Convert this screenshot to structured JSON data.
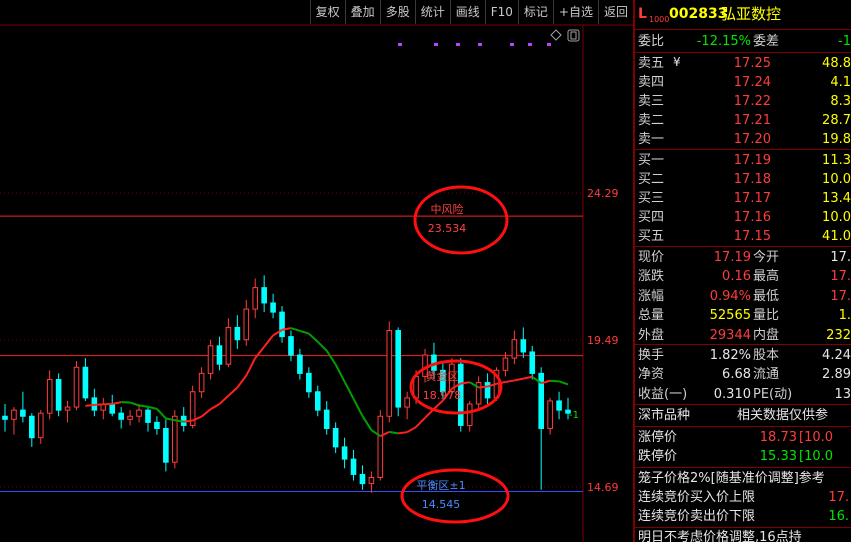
{
  "toolbar": {
    "buttons": [
      "复权",
      "叠加",
      "多股",
      "统计",
      "画线",
      "F10",
      "标记",
      "+自选",
      "返回"
    ]
  },
  "axis": {
    "price_labels": [
      "24.29",
      "19.49",
      "14.69"
    ]
  },
  "annotations": {
    "risk": {
      "title": "中风险",
      "value": "23.534"
    },
    "gold": {
      "title": "黄金区",
      "value": "18.978"
    },
    "balance": {
      "title": "平衡区±1",
      "value": "14.545"
    },
    "right_mark": "-1"
  },
  "stock": {
    "code": "002833",
    "name": "弘亚数控",
    "badge_top": "L",
    "badge_sub": "1000"
  },
  "weibi": {
    "label1": "委比",
    "value1": "-12.15%",
    "label2": "委差",
    "value2": "-1"
  },
  "asks": [
    {
      "label": "卖五",
      "price": "17.25",
      "vol": "48.8"
    },
    {
      "label": "卖四",
      "price": "17.24",
      "vol": "4.1"
    },
    {
      "label": "卖三",
      "price": "17.22",
      "vol": "8.3"
    },
    {
      "label": "卖二",
      "price": "17.21",
      "vol": "28.7"
    },
    {
      "label": "卖一",
      "price": "17.20",
      "vol": "19.8"
    }
  ],
  "ask_mark": "¥",
  "bids": [
    {
      "label": "买一",
      "price": "17.19",
      "vol": "11.3"
    },
    {
      "label": "买二",
      "price": "17.18",
      "vol": "10.0"
    },
    {
      "label": "买三",
      "price": "17.17",
      "vol": "13.4"
    },
    {
      "label": "买四",
      "price": "17.16",
      "vol": "10.0"
    },
    {
      "label": "买五",
      "price": "17.15",
      "vol": "41.0"
    }
  ],
  "quote": [
    {
      "l1": "现价",
      "v1": "17.19",
      "l2": "今开",
      "v2": "17."
    },
    {
      "l1": "涨跌",
      "v1": "0.16",
      "l2": "最高",
      "v2": "17."
    },
    {
      "l1": "涨幅",
      "v1": "0.94%",
      "l2": "最低",
      "v2": "17."
    },
    {
      "l1": "总量",
      "v1": "52565",
      "l2": "量比",
      "v2": "1."
    },
    {
      "l1": "外盘",
      "v1": "29344",
      "l2": "内盘",
      "v2": "232"
    }
  ],
  "fund": [
    {
      "l1": "换手",
      "v1": "1.82%",
      "l2": "股本",
      "v2": "4.24"
    },
    {
      "l1": "净资",
      "v1": "6.68",
      "l2": "流通",
      "v2": "2.89"
    },
    {
      "l1": "收益(一)",
      "v1": "0.310",
      "l2": "PE(动)",
      "v2": "13"
    }
  ],
  "market_row": {
    "left": "深市品种",
    "right": "相关数据仅供参"
  },
  "limits": [
    {
      "label": "涨停价",
      "value": "18.73",
      "suffix": "[10.0"
    },
    {
      "label": "跌停价",
      "value": "15.33",
      "suffix": "[10.0"
    }
  ],
  "cage": {
    "line1": "笼子价格2%[随基准价调整]参考",
    "buy_label": "连续竞价买入价上限",
    "buy_value": "17.",
    "sell_label": "连续竞价卖出价下限",
    "sell_value": "16."
  },
  "bottom_text": "明日不考虑价格调整,16点持",
  "colors": {
    "up": "#ff3c3c",
    "down": "#00ffff",
    "ma_up": "#ff2020",
    "ma_down": "#00a000",
    "blue_line": "#3050ff"
  },
  "chart_data": {
    "type": "candlestick",
    "ylim": [
      14.69,
      24.29
    ],
    "gridlines": [
      24.29,
      19.49,
      14.69
    ],
    "levels": [
      {
        "name": "中风险",
        "value": 23.534
      },
      {
        "name": "黄金区",
        "value": 18.978
      },
      {
        "name": "平衡区±1",
        "value": 14.545
      }
    ],
    "candles": [
      [
        17.0,
        17.4,
        16.5,
        16.9
      ],
      [
        16.9,
        17.3,
        16.4,
        17.2
      ],
      [
        17.2,
        17.8,
        16.8,
        17.0
      ],
      [
        17.0,
        17.1,
        16.0,
        16.3
      ],
      [
        16.3,
        17.2,
        16.1,
        17.1
      ],
      [
        17.1,
        18.5,
        16.9,
        18.2
      ],
      [
        18.2,
        18.4,
        17.0,
        17.2
      ],
      [
        17.2,
        17.5,
        16.8,
        17.3
      ],
      [
        17.3,
        18.8,
        17.2,
        18.6
      ],
      [
        18.6,
        18.9,
        17.5,
        17.6
      ],
      [
        17.6,
        17.9,
        17.0,
        17.2
      ],
      [
        17.2,
        17.6,
        16.9,
        17.4
      ],
      [
        17.4,
        17.7,
        17.0,
        17.1
      ],
      [
        17.1,
        17.3,
        16.6,
        16.9
      ],
      [
        16.9,
        17.2,
        16.7,
        17.0
      ],
      [
        17.0,
        17.4,
        16.8,
        17.2
      ],
      [
        17.2,
        17.3,
        16.5,
        16.8
      ],
      [
        16.8,
        17.0,
        16.4,
        16.6
      ],
      [
        16.6,
        16.9,
        15.2,
        15.5
      ],
      [
        15.5,
        17.2,
        15.3,
        17.0
      ],
      [
        17.0,
        17.3,
        16.5,
        16.7
      ],
      [
        16.7,
        18.0,
        16.6,
        17.8
      ],
      [
        17.8,
        18.6,
        17.6,
        18.4
      ],
      [
        18.4,
        19.5,
        18.2,
        19.3
      ],
      [
        19.3,
        19.6,
        18.5,
        18.7
      ],
      [
        18.7,
        20.2,
        18.6,
        19.9
      ],
      [
        19.9,
        20.3,
        19.2,
        19.5
      ],
      [
        19.5,
        20.8,
        19.3,
        20.5
      ],
      [
        20.5,
        21.5,
        20.2,
        21.2
      ],
      [
        21.2,
        21.6,
        20.4,
        20.7
      ],
      [
        20.7,
        21.0,
        20.2,
        20.4
      ],
      [
        20.4,
        20.6,
        19.4,
        19.6
      ],
      [
        19.6,
        19.8,
        18.8,
        19.0
      ],
      [
        19.0,
        19.2,
        18.2,
        18.4
      ],
      [
        18.4,
        18.6,
        17.6,
        17.8
      ],
      [
        17.8,
        18.0,
        17.0,
        17.2
      ],
      [
        17.2,
        17.5,
        16.4,
        16.6
      ],
      [
        16.6,
        16.8,
        15.8,
        16.0
      ],
      [
        16.0,
        16.3,
        15.3,
        15.6
      ],
      [
        15.6,
        15.9,
        14.9,
        15.1
      ],
      [
        15.1,
        15.4,
        14.6,
        14.8
      ],
      [
        14.8,
        15.2,
        14.5,
        15.0
      ],
      [
        15.0,
        17.2,
        14.9,
        17.0
      ],
      [
        17.0,
        20.1,
        16.8,
        19.8
      ],
      [
        19.8,
        19.9,
        17.0,
        17.3
      ],
      [
        17.3,
        17.8,
        16.9,
        17.6
      ],
      [
        17.6,
        18.5,
        17.4,
        18.3
      ],
      [
        18.3,
        19.2,
        18.1,
        19.0
      ],
      [
        19.0,
        19.4,
        18.2,
        18.5
      ],
      [
        18.5,
        18.8,
        17.6,
        17.8
      ],
      [
        17.8,
        18.9,
        17.7,
        18.7
      ],
      [
        18.7,
        18.9,
        16.5,
        16.7
      ],
      [
        16.7,
        17.5,
        16.5,
        17.4
      ],
      [
        17.4,
        18.3,
        17.2,
        18.1
      ],
      [
        18.1,
        18.4,
        17.4,
        17.6
      ],
      [
        17.6,
        18.6,
        17.5,
        18.5
      ],
      [
        18.5,
        19.1,
        18.3,
        18.9
      ],
      [
        18.9,
        19.8,
        18.7,
        19.5
      ],
      [
        19.5,
        19.9,
        18.9,
        19.1
      ],
      [
        19.1,
        19.3,
        18.2,
        18.4
      ],
      [
        18.4,
        18.6,
        14.6,
        16.6
      ],
      [
        16.6,
        17.6,
        16.4,
        17.5
      ],
      [
        17.5,
        17.8,
        16.9,
        17.2
      ],
      [
        17.2,
        17.6,
        16.9,
        17.1
      ]
    ]
  }
}
